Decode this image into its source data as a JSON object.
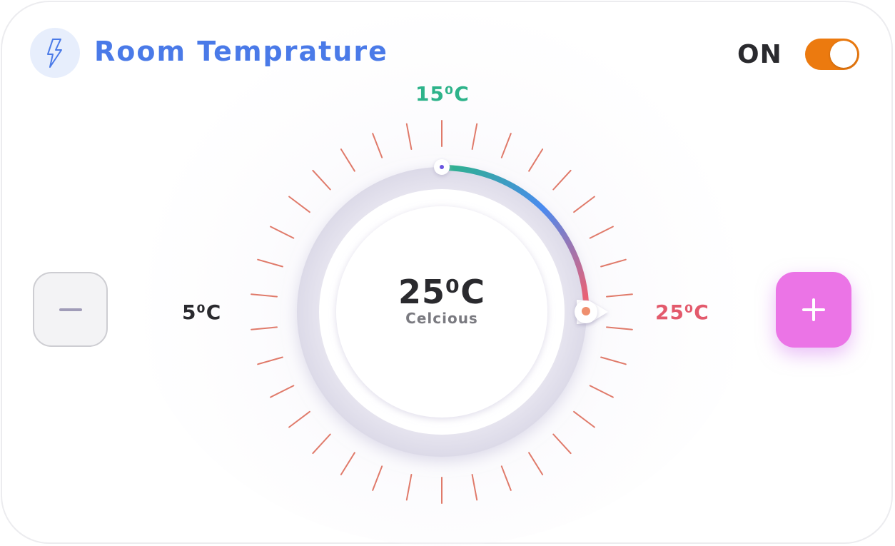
{
  "header": {
    "title": "Room Temprature",
    "icon": "lightning-icon",
    "power_label": "ON",
    "power_on": true
  },
  "dial": {
    "min_label": "5⁰C",
    "mid_label": "15⁰C",
    "max_label": "25⁰C",
    "current_value": "25⁰C",
    "unit_label": "Celcious"
  },
  "controls": {
    "decrease_icon": "minus-icon",
    "increase_icon": "plus-icon"
  },
  "colors": {
    "title": "#4a7ae8",
    "toggle_on": "#ec7a0f",
    "tick": "#e07a6a",
    "arc_start": "#2db38a",
    "arc_mid": "#4a8af0",
    "arc_end": "#ef6070",
    "plus_button": "#eb74e6",
    "min_label": "#2a2a2e",
    "mid_label": "#2db38a",
    "max_label": "#e35a6c"
  }
}
